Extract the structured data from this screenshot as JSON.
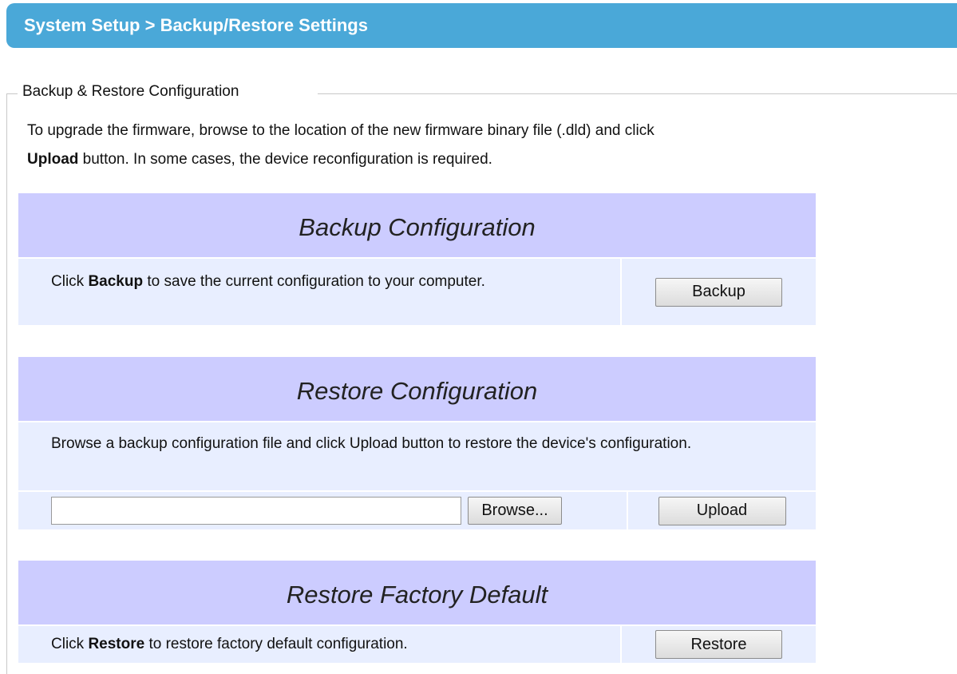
{
  "header": {
    "title": "System Setup > Backup/Restore Settings"
  },
  "fieldset": {
    "legend": "Backup & Restore Configuration"
  },
  "intro": {
    "line1": "To upgrade the firmware, browse to the location of the new firmware binary file (.dld) and click",
    "bold": "Upload",
    "line2_rest": " button. In some cases, the device reconfiguration is required."
  },
  "backup": {
    "title": "Backup Configuration",
    "text_pre": "Click ",
    "text_bold": "Backup",
    "text_post": " to save the current configuration to your computer.",
    "button": "Backup"
  },
  "restore": {
    "title": "Restore Configuration",
    "text": "Browse a backup configuration file and click Upload button to restore the device's configuration.",
    "file_value": "",
    "browse_button": "Browse...",
    "upload_button": "Upload"
  },
  "factory": {
    "title": "Restore Factory Default",
    "text_pre": "Click ",
    "text_bold": "Restore",
    "text_post": " to restore factory default configuration.",
    "button": "Restore"
  }
}
